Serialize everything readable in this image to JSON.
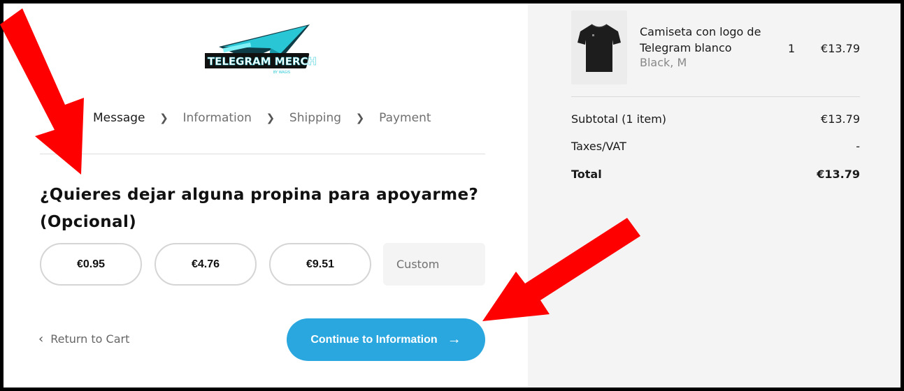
{
  "breadcrumbs": [
    {
      "label": "Message",
      "active": true
    },
    {
      "label": "Information",
      "active": false
    },
    {
      "label": "Shipping",
      "active": false
    },
    {
      "label": "Payment",
      "active": false
    }
  ],
  "logo": {
    "title": "TELEGRAM MERCH",
    "subtitle": "BY WAGIS"
  },
  "tip_section": {
    "heading": "¿Quieres dejar alguna propina para apoyarme? (Opcional)",
    "options": [
      "€0.95",
      "€4.76",
      "€9.51"
    ],
    "custom_placeholder": "Custom"
  },
  "nav": {
    "return_label": "Return to Cart",
    "continue_label": "Continue to Information"
  },
  "cart": {
    "item": {
      "name": "Camiseta con logo de Telegram blanco",
      "variant": "Black, M",
      "quantity": "1",
      "price": "€13.79"
    },
    "subtotal_label": "Subtotal (1 item)",
    "subtotal_value": "€13.79",
    "taxes_label": "Taxes/VAT",
    "taxes_value": "-",
    "total_label": "Total",
    "total_value": "€13.79"
  },
  "colors": {
    "accent": "#2ba7e0",
    "annotation_arrow": "#ff0000",
    "summary_bg": "#f4f4f4"
  }
}
